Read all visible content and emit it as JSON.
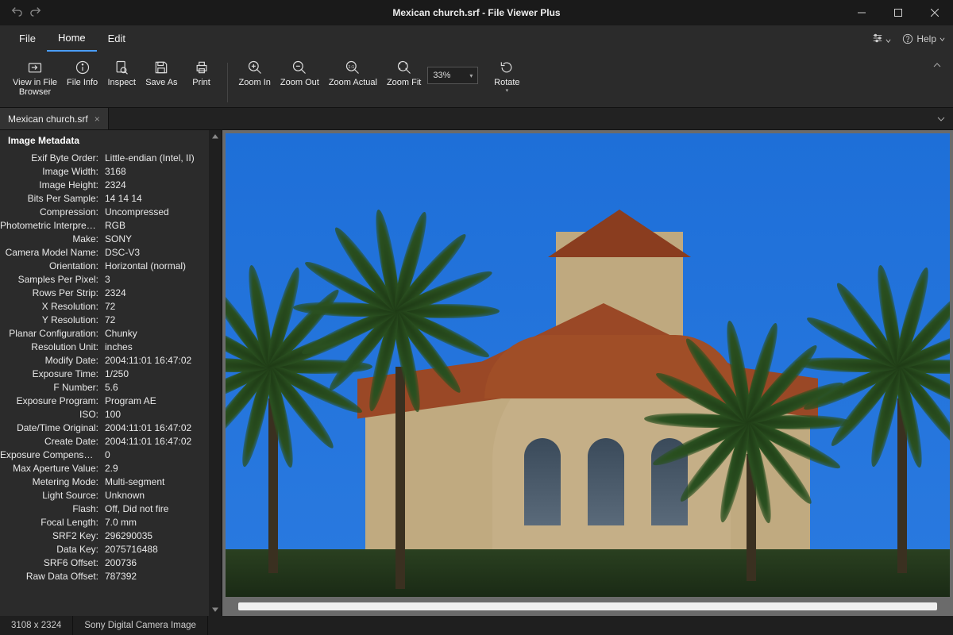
{
  "window": {
    "title": "Mexican church.srf - File Viewer Plus"
  },
  "menu": {
    "file": "File",
    "home": "Home",
    "edit": "Edit",
    "help": "Help"
  },
  "ribbon": {
    "view_in_browser": "View in File\nBrowser",
    "file_info": "File Info",
    "inspect": "Inspect",
    "save_as": "Save As",
    "print": "Print",
    "zoom_in": "Zoom In",
    "zoom_out": "Zoom Out",
    "zoom_actual": "Zoom Actual",
    "zoom_fit": "Zoom Fit",
    "zoom_value": "33%",
    "rotate": "Rotate"
  },
  "tab": {
    "name": "Mexican church.srf"
  },
  "sidebar": {
    "title": "Image Metadata",
    "rows": [
      {
        "k": "Exif Byte Order:",
        "v": "Little-endian (Intel, II)"
      },
      {
        "k": "Image Width:",
        "v": "3168"
      },
      {
        "k": "Image Height:",
        "v": "2324"
      },
      {
        "k": "Bits Per Sample:",
        "v": "14 14 14"
      },
      {
        "k": "Compression:",
        "v": "Uncompressed"
      },
      {
        "k": "Photometric Interpretat...:",
        "v": "RGB"
      },
      {
        "k": "Make:",
        "v": "SONY"
      },
      {
        "k": "Camera Model Name:",
        "v": "DSC-V3"
      },
      {
        "k": "Orientation:",
        "v": "Horizontal (normal)"
      },
      {
        "k": "Samples Per Pixel:",
        "v": "3"
      },
      {
        "k": "Rows Per Strip:",
        "v": "2324"
      },
      {
        "k": "X Resolution:",
        "v": "72"
      },
      {
        "k": "Y Resolution:",
        "v": "72"
      },
      {
        "k": "Planar Configuration:",
        "v": "Chunky"
      },
      {
        "k": "Resolution Unit:",
        "v": "inches"
      },
      {
        "k": "Modify Date:",
        "v": "2004:11:01 16:47:02"
      },
      {
        "k": "Exposure Time:",
        "v": "1/250"
      },
      {
        "k": "F Number:",
        "v": "5.6"
      },
      {
        "k": "Exposure Program:",
        "v": "Program AE"
      },
      {
        "k": "ISO:",
        "v": "100"
      },
      {
        "k": "Date/Time Original:",
        "v": "2004:11:01 16:47:02"
      },
      {
        "k": "Create Date:",
        "v": "2004:11:01 16:47:02"
      },
      {
        "k": "Exposure Compensation:",
        "v": "0"
      },
      {
        "k": "Max Aperture Value:",
        "v": "2.9"
      },
      {
        "k": "Metering Mode:",
        "v": "Multi-segment"
      },
      {
        "k": "Light Source:",
        "v": "Unknown"
      },
      {
        "k": "Flash:",
        "v": "Off, Did not fire"
      },
      {
        "k": "Focal Length:",
        "v": "7.0 mm"
      },
      {
        "k": "SRF2 Key:",
        "v": "296290035"
      },
      {
        "k": "Data Key:",
        "v": "2075716488"
      },
      {
        "k": "SRF6 Offset:",
        "v": "200736"
      },
      {
        "k": "Raw Data Offset:",
        "v": "787392"
      }
    ]
  },
  "status": {
    "dimensions": "3108 x 2324",
    "filetype": "Sony Digital Camera Image"
  }
}
